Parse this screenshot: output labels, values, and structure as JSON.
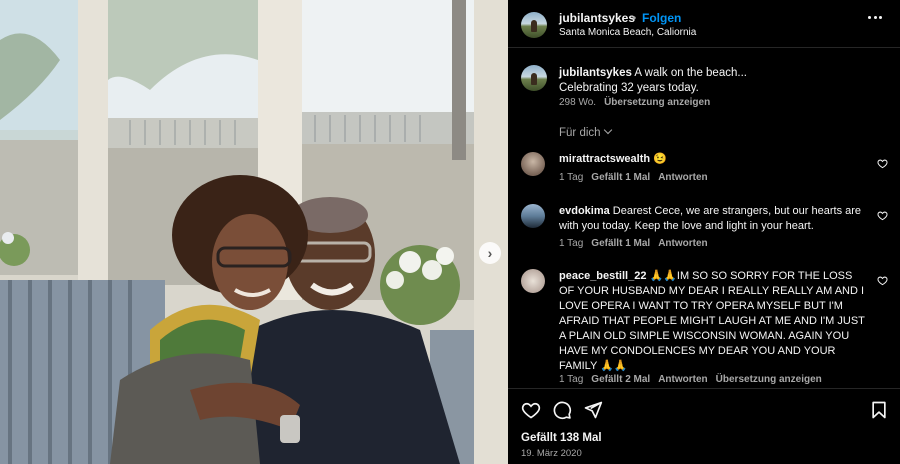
{
  "post": {
    "username": "jubilantsykes",
    "separator": "•",
    "follow_label": "Folgen",
    "location": "Santa Monica Beach, Caliornia",
    "photo_alt": "Two people hugging by a window"
  },
  "caption": {
    "username": "jubilantsykes",
    "text_line1": " A walk on the beach...",
    "text_line2": "Celebrating 32 years today.",
    "age": "298 Wo.",
    "translate_label": "Übersetzung anzeigen"
  },
  "sort_label": "Für dich",
  "comments": [
    {
      "username": "mirattractswealth",
      "text": " 😉",
      "age": "1 Tag",
      "likes": "Gefällt 1 Mal",
      "reply": "Antworten",
      "translate": ""
    },
    {
      "username": "evdokima",
      "text": " Dearest Cece, we are strangers, but our hearts are with you today. Keep the love and light in your heart.",
      "age": "1 Tag",
      "likes": "Gefällt 1 Mal",
      "reply": "Antworten",
      "translate": ""
    },
    {
      "username": "peace_bestill_22",
      "text": " 🙏🙏IM SO SO SORRY FOR THE LOSS OF YOUR HUSBAND MY DEAR I REALLY REALLY AM AND I LOVE OPERA I WANT TO TRY OPERA MYSELF BUT I'M AFRAID THAT PEOPLE MIGHT LAUGH AT ME AND I'M JUST A PLAIN OLD SIMPLE WISCONSIN WOMAN. AGAIN YOU HAVE MY CONDOLENCES MY DEAR YOU AND YOUR FAMILY 🙏🙏",
      "age": "1 Tag",
      "likes": "Gefällt 2 Mal",
      "reply": "Antworten",
      "translate": "Übersetzung anzeigen"
    }
  ],
  "footer": {
    "likes": "Gefällt 138 Mal",
    "date": "19. März 2020"
  },
  "icons": {
    "like": "heart-icon",
    "comment": "comment-icon",
    "share": "share-icon",
    "save": "bookmark-icon",
    "more": "more-icon",
    "next": "chevron-right-icon"
  },
  "colors": {
    "background": "#000000",
    "text": "#f5f5f5",
    "secondary": "#a8a8a8",
    "accent": "#0095f6"
  }
}
